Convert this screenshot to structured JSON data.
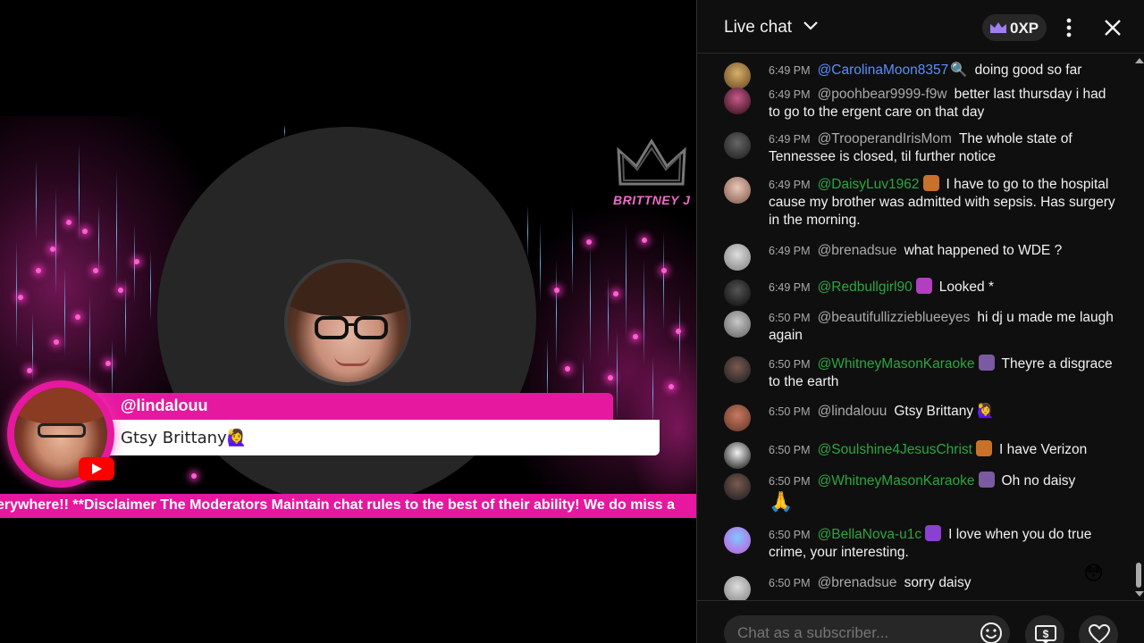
{
  "stream": {
    "brand_name": "BRITTNEY J",
    "highlight": {
      "author": "@lindalouu",
      "message": "Gtsy Brittany🙋‍♀️"
    },
    "ticker": "erywhere!! **Disclaimer The Moderators Maintain chat rules to the best of their ability! We do miss a"
  },
  "chat": {
    "title": "Live chat",
    "xp": "0XP",
    "input_placeholder": "Chat as a subscriber...",
    "reaction_emoji": "😳",
    "messages": [
      {
        "time": "6:49 PM",
        "author": "@CarolinaMoon8357",
        "author_style": "blue",
        "text": "doing good so far",
        "icon": "🔍"
      },
      {
        "time": "6:49 PM",
        "author": "@poohbear9999-f9w",
        "author_style": "plain",
        "text": "better last thursday i had to go to the ergent care on that day"
      },
      {
        "time": "6:49 PM",
        "author": "@TrooperandIrisMom",
        "author_style": "plain",
        "text": "The whole state of Tennessee is closed, til further notice"
      },
      {
        "time": "6:49 PM",
        "author": "@DaisyLuv1962",
        "author_style": "member",
        "text": "I have to go to the hospital cause my brother was admitted with sepsis. Has surgery in the morning."
      },
      {
        "time": "6:49 PM",
        "author": "@brenadsue",
        "author_style": "plain",
        "text": "what happened to WDE ?"
      },
      {
        "time": "6:49 PM",
        "author": "@Redbullgirl90",
        "author_style": "member",
        "text": "Looked *"
      },
      {
        "time": "6:50 PM",
        "author": "@beautifullizzieblueeyes",
        "author_style": "plain",
        "text": "hi dj u made me laugh again"
      },
      {
        "time": "6:50 PM",
        "author": "@WhitneyMasonKaraoke",
        "author_style": "member",
        "text": "Theyre a disgrace to the earth"
      },
      {
        "time": "6:50 PM",
        "author": "@lindalouu",
        "author_style": "plain",
        "text": "Gtsy Brittany 🙋‍♀️"
      },
      {
        "time": "6:50 PM",
        "author": "@Soulshine4JesusChrist",
        "author_style": "member",
        "text": "I have Verizon"
      },
      {
        "time": "6:50 PM",
        "author": "@WhitneyMasonKaraoke",
        "author_style": "member",
        "text": "Oh no daisy",
        "extra_line": "🙏"
      },
      {
        "time": "6:50 PM",
        "author": "@BellaNova-u1c",
        "author_style": "member",
        "text": "I love when you do true crime, your interesting."
      },
      {
        "time": "6:50 PM",
        "author": "@brenadsue",
        "author_style": "plain",
        "text": "sorry daisy"
      }
    ]
  },
  "colors": {
    "accent_pink": "#e5189f",
    "member_green": "#2ba640",
    "chat_bg": "#0f0f0f",
    "youtube_red": "#ff0000"
  },
  "icons": [
    "chevron-down-icon",
    "crown-icon",
    "more-vert-icon",
    "close-icon",
    "emoji-icon",
    "super-chat-icon",
    "heart-icon",
    "youtube-icon"
  ]
}
